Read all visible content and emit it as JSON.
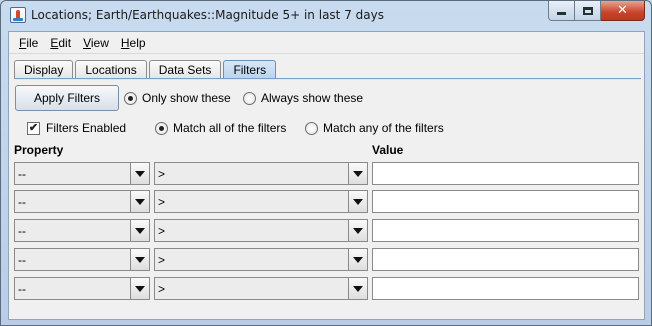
{
  "window": {
    "title": "Locations; Earth/Earthquakes::Magnitude 5+ in last 7 days",
    "close_glyph": "✕"
  },
  "menu": [
    {
      "label": "File",
      "mnemonic": "F",
      "rest": "ile"
    },
    {
      "label": "Edit",
      "mnemonic": "E",
      "rest": "dit"
    },
    {
      "label": "View",
      "mnemonic": "V",
      "rest": "iew"
    },
    {
      "label": "Help",
      "mnemonic": "H",
      "rest": "elp"
    }
  ],
  "tabs": [
    {
      "label": "Display",
      "active": false
    },
    {
      "label": "Locations",
      "active": false
    },
    {
      "label": "Data Sets",
      "active": false
    },
    {
      "label": "Filters",
      "active": true
    }
  ],
  "filters": {
    "apply_button": "Apply Filters",
    "show_mode": {
      "options": [
        "Only show these",
        "Always show these"
      ],
      "selected": "Only show these"
    },
    "enabled": {
      "label": "Filters Enabled",
      "checked": true,
      "check_glyph": "✔"
    },
    "match_mode": {
      "options": [
        "Match all of the filters",
        "Match any of the filters"
      ],
      "selected": "Match all of the filters"
    },
    "headers": {
      "property": "Property",
      "value": "Value"
    },
    "rows": [
      {
        "property": "--",
        "operator": ">",
        "value": ""
      },
      {
        "property": "--",
        "operator": ">",
        "value": ""
      },
      {
        "property": "--",
        "operator": ">",
        "value": ""
      },
      {
        "property": "--",
        "operator": ">",
        "value": ""
      },
      {
        "property": "--",
        "operator": ">",
        "value": ""
      }
    ]
  }
}
